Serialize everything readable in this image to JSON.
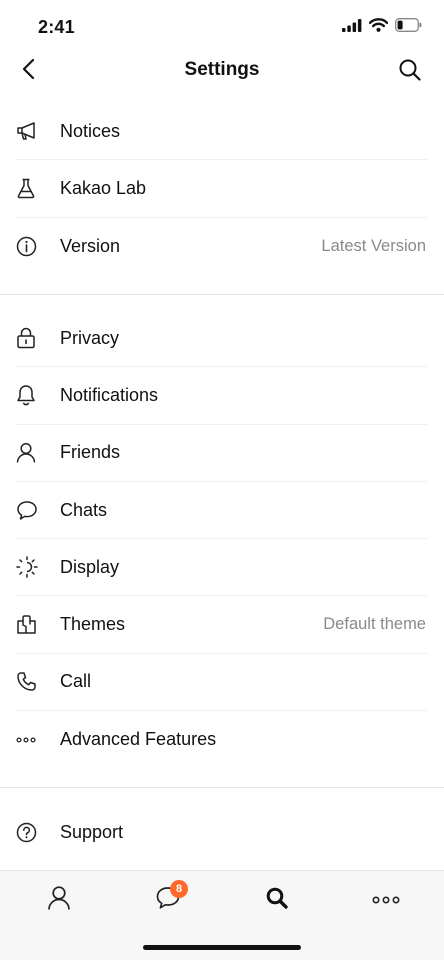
{
  "status_bar": {
    "time": "2:41",
    "icons": [
      "cellular-signal-icon",
      "wifi-icon",
      "battery-icon"
    ]
  },
  "nav": {
    "title": "Settings",
    "back_icon": "chevron-left-icon",
    "search_icon": "search-icon"
  },
  "section_1": [
    {
      "icon": "megaphone-icon",
      "label": "Notices"
    },
    {
      "icon": "flask-icon",
      "label": "Kakao Lab"
    },
    {
      "icon": "info-icon",
      "label": "Version",
      "value": "Latest Version"
    }
  ],
  "section_2": [
    {
      "icon": "lock-icon",
      "label": "Privacy"
    },
    {
      "icon": "bell-icon",
      "label": "Notifications"
    },
    {
      "icon": "person-icon",
      "label": "Friends"
    },
    {
      "icon": "chat-bubble-icon",
      "label": "Chats"
    },
    {
      "icon": "brightness-icon",
      "label": "Display"
    },
    {
      "icon": "theme-icon",
      "label": "Themes",
      "value": "Default theme"
    },
    {
      "icon": "phone-icon",
      "label": "Call"
    },
    {
      "icon": "more-dots-icon",
      "label": "Advanced Features"
    }
  ],
  "section_3": [
    {
      "icon": "help-icon",
      "label": "Support"
    }
  ],
  "tab_bar": {
    "tabs": [
      {
        "icon": "person-icon",
        "name": "friends"
      },
      {
        "icon": "chat-bubble-icon",
        "name": "chats",
        "badge": "8"
      },
      {
        "icon": "search-icon",
        "name": "search",
        "active": true
      },
      {
        "icon": "more-dots-icon",
        "name": "more"
      }
    ],
    "badge_color": "#ff6a2c"
  },
  "colors": {
    "text": "#111111",
    "secondary_text": "#8a8a8a",
    "divider": "#e6e6e6",
    "tab_bar_bg": "#f7f7f7"
  }
}
